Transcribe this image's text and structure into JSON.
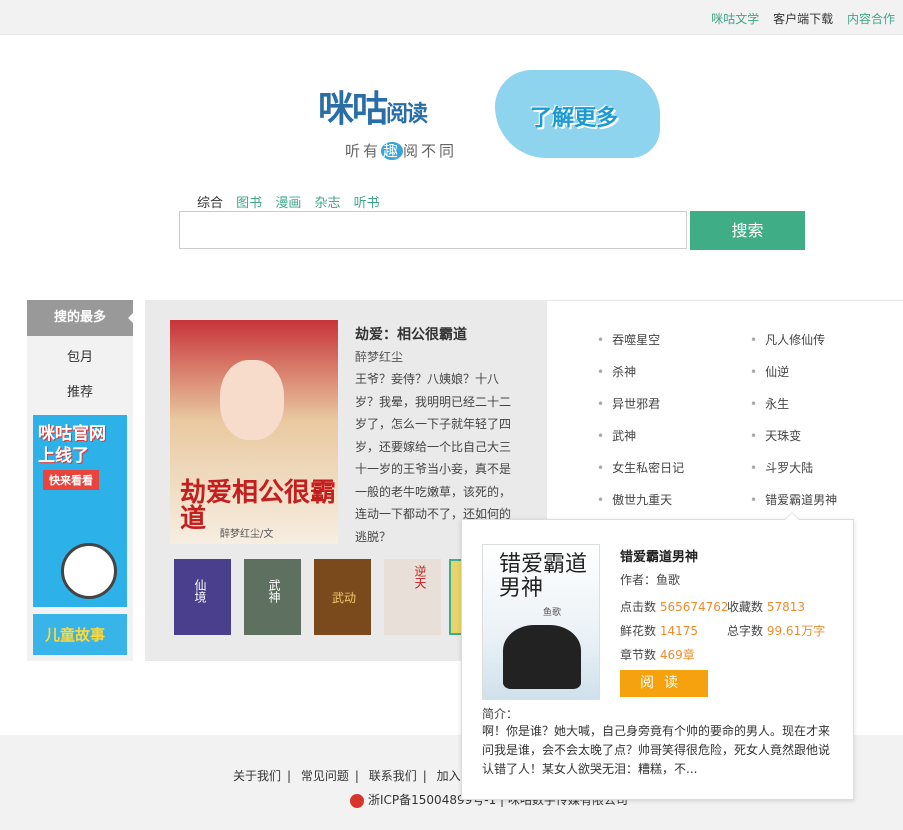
{
  "topbar": {
    "links": [
      "咪咕文学",
      "客户端下载",
      "内容合作"
    ]
  },
  "logo": {
    "name_part1": "咪咕",
    "name_part2": "阅读",
    "slogan_a": "听有",
    "slogan_q": "趣",
    "slogan_b": "阅不同",
    "promo": "了解更多"
  },
  "search": {
    "tabs": [
      "综合",
      "图书",
      "漫画",
      "杂志",
      "听书"
    ],
    "button": "搜索",
    "value": ""
  },
  "left_nav": {
    "items": [
      "搜的最多",
      "包月",
      "推荐"
    ],
    "ad1": {
      "line1": "咪咕官网",
      "line2": "上线了",
      "badge": "快来看看"
    },
    "ad2": {
      "text": "儿童故事"
    }
  },
  "feature": {
    "cover_text": "劫爱相公很霸道",
    "cover_author": "醉梦红尘/文",
    "title": "劫爱：相公很霸道",
    "author": "醉梦红尘",
    "desc": "王爷？妾侍？八姨娘？十八岁？我晕，我明明已经二十二岁了，怎么一下子就年轻了四岁，还要嫁给一个比自己大三十一岁的王爷当小妾，真不是一般的老牛吃嫩草，该死的，连动一下都动不了，还如何的逃脱？",
    "thumbs": [
      {
        "label": "仙境",
        "color": "#4a3f8c"
      },
      {
        "label": "武神",
        "color": "#5e7060"
      },
      {
        "label": "武动",
        "color": "#7a4a1c"
      },
      {
        "label": "逆天",
        "color": "#e8e0d8"
      },
      {
        "label": "",
        "color": "#e8d46a"
      }
    ]
  },
  "ranking": [
    "吞噬星空",
    "凡人修仙传",
    "杀神",
    "仙逆",
    "异世邪君",
    "永生",
    "武神",
    "天珠变",
    "女生私密日记",
    "斗罗大陆",
    "傲世九重天",
    "错爱霸道男神"
  ],
  "popup": {
    "cover_title": "错爱霸道男神",
    "cover_author": "鱼歌",
    "title": "错爱霸道男神",
    "author_label": "作者：",
    "author": "鱼歌",
    "clicks_label": "点击数",
    "clicks": "565674762",
    "favs_label": "收藏数",
    "favs": "57813",
    "flowers_label": "鲜花数",
    "flowers": "14175",
    "words_label": "总字数",
    "words": "99.61万字",
    "chapters_label": "章节数",
    "chapters": "469章",
    "read_button": "阅读",
    "intro_label": "简介：",
    "intro": "啊！你是谁？她大喊，自己身旁竟有个帅的要命的男人。现在才来问我是谁，会不会太晚了点？帅哥笑得很危险，死女人竟然跟他说认错了人！某女人欲哭无泪：糟糕，不..."
  },
  "footer": {
    "links": [
      "关于我们",
      "常见问题",
      "联系我们",
      "加入我们"
    ],
    "icp": "浙ICP备15004899号-1 | 咪咕数字传媒有限公司"
  },
  "colors": {
    "accent": "#3fae87",
    "orange": "#f08b2c",
    "button_orange": "#f5a20e",
    "brand_blue": "#2a6ea8"
  }
}
